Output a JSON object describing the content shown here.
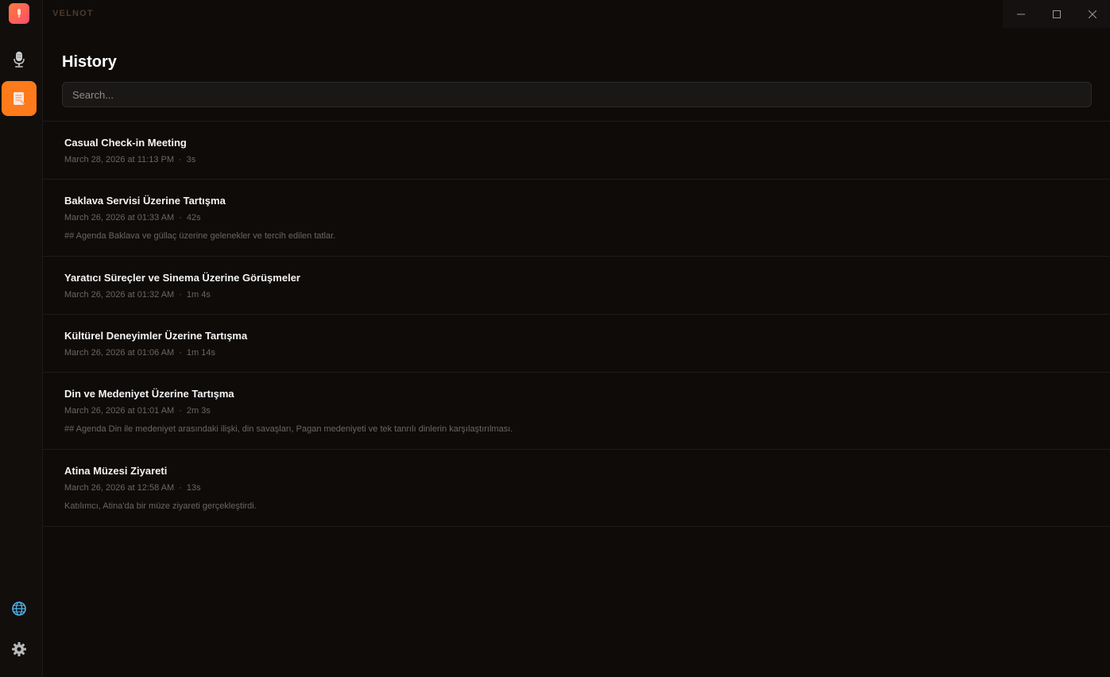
{
  "app": {
    "brand": "VELNOT"
  },
  "colors": {
    "accent": "#ff7a1a",
    "logo_gradient": [
      "#ff7a3d",
      "#ff4d6d"
    ],
    "background": "#0e0b09"
  },
  "sidebar": {
    "items": [
      {
        "name": "record",
        "icon": "microphone-icon",
        "active": false
      },
      {
        "name": "history",
        "icon": "notes-icon",
        "active": true
      },
      {
        "name": "language",
        "icon": "globe-icon",
        "active": false
      },
      {
        "name": "settings",
        "icon": "gear-icon",
        "active": false
      }
    ]
  },
  "window_controls": {
    "minimize": "minimize-icon",
    "maximize": "maximize-icon",
    "close": "close-icon"
  },
  "page": {
    "title": "History",
    "search": {
      "placeholder": "Search...",
      "value": ""
    }
  },
  "history": [
    {
      "title": "Casual Check-in Meeting",
      "date": "March 28, 2026 at 11:13 PM",
      "duration": "3s",
      "preview": ""
    },
    {
      "title": "Baklava Servisi Üzerine Tartışma",
      "date": "March 26, 2026 at 01:33 AM",
      "duration": "42s",
      "preview": "## Agenda Baklava ve güllaç üzerine gelenekler ve tercih edilen tatlar."
    },
    {
      "title": "Yaratıcı Süreçler ve Sinema Üzerine Görüşmeler",
      "date": "March 26, 2026 at 01:32 AM",
      "duration": "1m 4s",
      "preview": ""
    },
    {
      "title": "Kültürel Deneyimler Üzerine Tartışma",
      "date": "March 26, 2026 at 01:06 AM",
      "duration": "1m 14s",
      "preview": ""
    },
    {
      "title": "Din ve Medeniyet Üzerine Tartışma",
      "date": "March 26, 2026 at 01:01 AM",
      "duration": "2m 3s",
      "preview": "## Agenda Din ile medeniyet arasındaki ilişki, din savaşları, Pagan medeniyeti ve tek tanrılı dinlerin karşılaştırılması."
    },
    {
      "title": "Atina Müzesi Ziyareti",
      "date": "March 26, 2026 at 12:58 AM",
      "duration": "13s",
      "preview": "Katılımcı, Atina'da bir müze ziyareti gerçekleştirdi."
    }
  ]
}
